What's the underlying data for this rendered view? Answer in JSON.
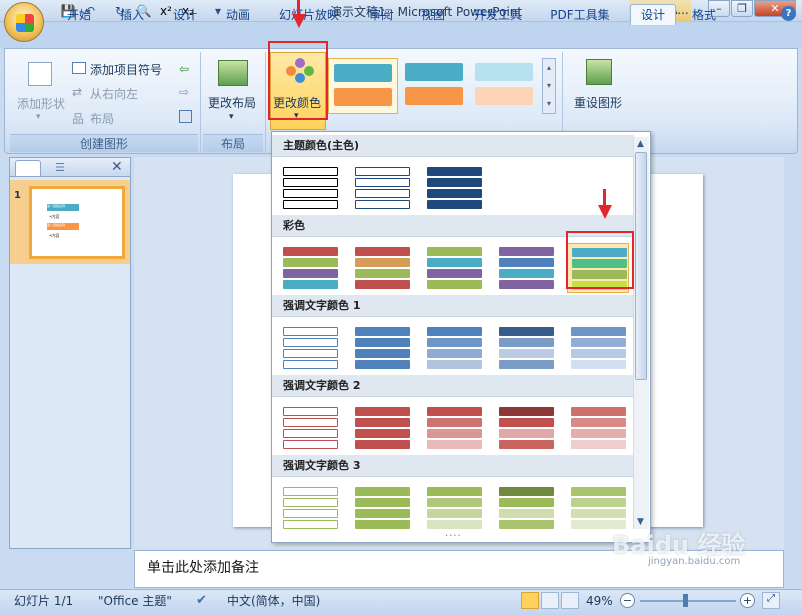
{
  "window": {
    "title": "演示文稿1 - Microsoft PowerPoint",
    "context_tab": "SmartA..."
  },
  "qat": {
    "save": "💾",
    "undo": "↶",
    "redo": "↻",
    "preview": "🔍",
    "superscript": "x²",
    "subscript": "x₂",
    "more": "▾"
  },
  "window_buttons": {
    "minimize": "–",
    "restore": "❐",
    "close": "✕"
  },
  "tabs": [
    "开始",
    "插入",
    "设计",
    "动画",
    "幻灯片放映",
    "审阅",
    "视图",
    "开发工具",
    "PDF工具集",
    "设计",
    "格式"
  ],
  "active_tab_index": 9,
  "ribbon": {
    "create_graphic": {
      "label": "创建图形",
      "add_shape": "添加形状",
      "add_bullet": "添加项目符号",
      "right_to_left": "从右向左",
      "layout": "布局"
    },
    "layouts": {
      "label": "布局",
      "change_layout": "更改布局"
    },
    "change_colors": "更改颜色",
    "reset_graphic": "重设图形"
  },
  "styles_swatches": [
    {
      "top": "#4bacc6",
      "bottom": "#f79646"
    },
    {
      "top": "#4bacc6",
      "bottom": "#f79646"
    },
    {
      "top": "#b7e1ef",
      "bottom": "#fbd5b5"
    }
  ],
  "gallery": {
    "sections": [
      {
        "title": "主题颜色(主色)",
        "variants": [
          {
            "style": "outline",
            "colors": [
              "#000000",
              "#000000",
              "#000000",
              "#000000"
            ]
          },
          {
            "style": "outline",
            "colors": [
              "#1f497d",
              "#1f497d",
              "#1f497d",
              "#1f497d"
            ]
          },
          {
            "style": "fill",
            "colors": [
              "#1f497d",
              "#1f497d",
              "#1f497d",
              "#1f497d"
            ]
          }
        ]
      },
      {
        "title": "彩色",
        "variants": [
          {
            "style": "fill",
            "colors": [
              "#c0504d",
              "#9bbb59",
              "#8064a2",
              "#4bacc6"
            ]
          },
          {
            "style": "fill",
            "colors": [
              "#c0504d",
              "#d79b5a",
              "#9bbb59",
              "#c0504d"
            ]
          },
          {
            "style": "fill",
            "colors": [
              "#9bbb59",
              "#4bacc6",
              "#8064a2",
              "#9bbb59"
            ]
          },
          {
            "style": "fill",
            "colors": [
              "#8064a2",
              "#4f81bd",
              "#4bacc6",
              "#8064a2"
            ]
          },
          {
            "style": "fill",
            "colors": [
              "#4bacc6",
              "#4fbf88",
              "#9bbb59",
              "#c6e046"
            ]
          }
        ]
      },
      {
        "title": "强调文字颜色 1",
        "variants": [
          {
            "style": "outline",
            "colors": [
              "#4f81bd",
              "#4f81bd",
              "#4f81bd",
              "#4f81bd"
            ]
          },
          {
            "style": "fill",
            "colors": [
              "#4f81bd",
              "#4f81bd",
              "#4f81bd",
              "#4f81bd"
            ]
          },
          {
            "style": "fill",
            "colors": [
              "#4f81bd",
              "#6e96c8",
              "#8eabd3",
              "#b0c4e0"
            ]
          },
          {
            "style": "fill",
            "colors": [
              "#385d8a",
              "#7b9cc7",
              "#b9cce4",
              "#7b9cc7"
            ]
          },
          {
            "style": "fill",
            "colors": [
              "#6f95c8",
              "#91afd6",
              "#b6cae5",
              "#d2dff0"
            ]
          }
        ]
      },
      {
        "title": "强调文字颜色 2",
        "variants": [
          {
            "style": "outline",
            "colors": [
              "#c0504d",
              "#c0504d",
              "#c0504d",
              "#c0504d"
            ]
          },
          {
            "style": "fill",
            "colors": [
              "#c0504d",
              "#c0504d",
              "#c0504d",
              "#c0504d"
            ]
          },
          {
            "style": "fill",
            "colors": [
              "#c0504d",
              "#cf7370",
              "#dc9795",
              "#e8bab9"
            ]
          },
          {
            "style": "fill",
            "colors": [
              "#8c3836",
              "#c0504d",
              "#e0a8a7",
              "#c96461"
            ]
          },
          {
            "style": "fill",
            "colors": [
              "#d0706d",
              "#d98a88",
              "#e5adab",
              "#eecdcc"
            ]
          }
        ]
      },
      {
        "title": "强调文字颜色 3",
        "variants": [
          {
            "style": "outline",
            "colors": [
              "#9bbb59",
              "#9bbb59",
              "#9bbb59",
              "#9bbb59"
            ]
          },
          {
            "style": "fill",
            "colors": [
              "#9bbb59",
              "#9bbb59",
              "#9bbb59",
              "#9bbb59"
            ]
          },
          {
            "style": "fill",
            "colors": [
              "#9bbb59",
              "#afc87a",
              "#c4d69c",
              "#d8e4bd"
            ]
          },
          {
            "style": "fill",
            "colors": [
              "#71893f",
              "#9bbb59",
              "#cfdcb0",
              "#a9c46c"
            ]
          },
          {
            "style": "fill",
            "colors": [
              "#aac46e",
              "#bdd28e",
              "#d1e0b0",
              "#e2ebcf"
            ]
          }
        ]
      }
    ]
  },
  "thumbnail": {
    "number": "1",
    "lines": [
      "第一层级名称",
      "•内容",
      "第二层级名称",
      "•内容"
    ]
  },
  "notes_placeholder": "单击此处添加备注",
  "status": {
    "slide": "幻灯片 1/1",
    "theme": "\"Office 主题\"",
    "language": "中文(简体，中国)",
    "zoom": "49%"
  },
  "watermark": {
    "text": "Baidu 经验",
    "sub": "jingyan.baidu.com"
  }
}
